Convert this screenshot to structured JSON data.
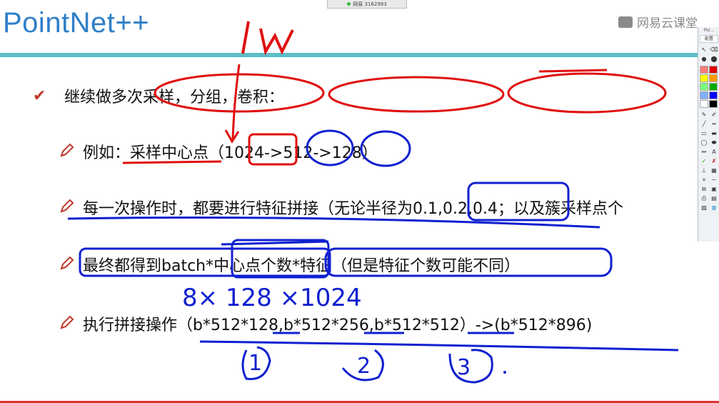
{
  "slide": {
    "title": "PointNet++",
    "watermark": "网易云课堂",
    "top_window_label": "网易 3162993",
    "bullets": [
      "继续做多次采样，分组，卷积：",
      "例如：采样中心点（1024->512->128）",
      "每一次操作时，都要进行特征拼接（无论半径为0.1,0.2,0.4；以及簇采样点个",
      "最终都得到batch*中心点个数*特征（但是特征个数可能不同）",
      "执行拼接操作（b*512*128,b*512*256,b*512*512）->(b*512*896)"
    ]
  },
  "annotations": {
    "top": "1w",
    "under_bullet4": "8× 128 ×1024",
    "numbers": [
      "1",
      "2",
      "3"
    ]
  },
  "toolbar": {
    "title": "Poi...",
    "config_label": "配置",
    "colors": [
      "#ff7b7b",
      "#e00000",
      "#ffff00",
      "#ff9900",
      "#7cff7c",
      "#00aa00",
      "#7fb2ff",
      "#0000ff",
      "#ffffff",
      "#000000"
    ]
  }
}
